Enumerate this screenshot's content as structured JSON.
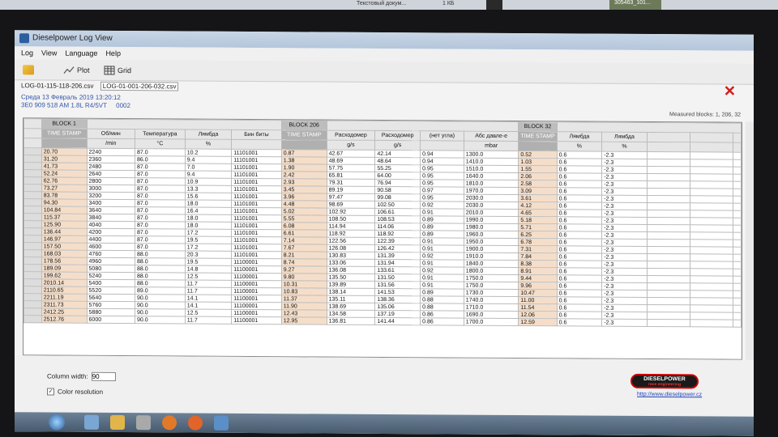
{
  "desktop": {
    "top_text": "Текстовый докум...",
    "top_size": "1 КБ",
    "thumb_label": "305463_101..."
  },
  "window": {
    "title": "Dieselpower Log View",
    "menu": [
      "Log",
      "View",
      "Language",
      "Help"
    ],
    "toolbar": {
      "plot": "Plot",
      "grid": "Grid"
    },
    "files": [
      "LOG-01-115-118-206.csv",
      "LOG-01-001-206-032.csv"
    ],
    "info_date": "Среда 13 Февраль 2019 13:20:12",
    "info_ecu": "3E0 909 518 AM  1.8L R4/5VT",
    "info_code": "0002",
    "measured": "Measured blocks: 1, 206, 32"
  },
  "grid": {
    "blocks": [
      "BLOCK 1",
      "BLOCK 206",
      "BLOCK 32"
    ],
    "headers": [
      "TIME STAMP",
      "Об/мин",
      "Температура",
      "Лямбда",
      "Бин биты",
      "TIME STAMP",
      "Расходомер",
      "Расходомер",
      "(нет угла)",
      "Абс давле-е",
      "TIME STAMP",
      "Лямбда",
      "Лямбда"
    ],
    "units": [
      "",
      "/min",
      "°C",
      "%",
      "",
      "",
      "g/s",
      "g/s",
      "",
      "mbar",
      "",
      "%",
      "%"
    ],
    "rows": [
      [
        "20.70",
        "2240",
        "87.0",
        "10.2",
        "11101001",
        "0.87",
        "42.67",
        "42.14",
        "0.94",
        "1300.0",
        "0.52",
        "0.6",
        "-2.3"
      ],
      [
        "31.20",
        "2360",
        "86.0",
        "9.4",
        "11101001",
        "1.38",
        "48.69",
        "48.64",
        "0.94",
        "1410.0",
        "1.03",
        "0.6",
        "-2.3"
      ],
      [
        "41.73",
        "2480",
        "87.0",
        "7.0",
        "11101001",
        "1.90",
        "57.75",
        "55.25",
        "0.95",
        "1510.0",
        "1.55",
        "0.6",
        "-2.3"
      ],
      [
        "52.24",
        "2640",
        "87.0",
        "9.4",
        "11101001",
        "2.42",
        "65.81",
        "64.00",
        "0.95",
        "1640.0",
        "2.06",
        "0.6",
        "-2.3"
      ],
      [
        "62.76",
        "2800",
        "87.0",
        "10.9",
        "11101001",
        "2.93",
        "79.31",
        "76.94",
        "0.95",
        "1810.0",
        "2.58",
        "0.6",
        "-2.3"
      ],
      [
        "73.27",
        "3000",
        "87.0",
        "13.3",
        "11101001",
        "3.45",
        "89.19",
        "90.58",
        "0.97",
        "1970.0",
        "3.09",
        "0.6",
        "-2.3"
      ],
      [
        "83.78",
        "3200",
        "87.0",
        "15.6",
        "11101001",
        "3.96",
        "97.47",
        "99.08",
        "0.95",
        "2030.0",
        "3.61",
        "0.6",
        "-2.3"
      ],
      [
        "94.30",
        "3400",
        "87.0",
        "18.0",
        "11101001",
        "4.48",
        "98.69",
        "102.50",
        "0.92",
        "2030.0",
        "4.12",
        "0.6",
        "-2.3"
      ],
      [
        "104.84",
        "3640",
        "87.0",
        "16.4",
        "11101001",
        "5.02",
        "102.92",
        "106.61",
        "0.91",
        "2010.0",
        "4.65",
        "0.6",
        "-2.3"
      ],
      [
        "115.37",
        "3840",
        "87.0",
        "18.0",
        "11101001",
        "5.55",
        "108.50",
        "108.53",
        "0.89",
        "1990.0",
        "5.18",
        "0.6",
        "-2.3"
      ],
      [
        "125.90",
        "4040",
        "87.0",
        "18.0",
        "11101001",
        "6.08",
        "114.94",
        "114.06",
        "0.89",
        "1980.0",
        "5.71",
        "0.6",
        "-2.3"
      ],
      [
        "136.44",
        "4200",
        "87.0",
        "17.2",
        "11101001",
        "6.61",
        "118.92",
        "118.92",
        "0.89",
        "1960.0",
        "6.25",
        "0.6",
        "-2.3"
      ],
      [
        "146.97",
        "4400",
        "87.0",
        "19.5",
        "11101001",
        "7.14",
        "122.56",
        "122.39",
        "0.91",
        "1950.0",
        "6.78",
        "0.6",
        "-2.3"
      ],
      [
        "157.50",
        "4600",
        "87.0",
        "17.2",
        "11101001",
        "7.67",
        "126.08",
        "126.42",
        "0.91",
        "1900.0",
        "7.31",
        "0.6",
        "-2.3"
      ],
      [
        "168.03",
        "4760",
        "88.0",
        "20.3",
        "11101001",
        "8.21",
        "130.83",
        "131.39",
        "0.92",
        "1910.0",
        "7.84",
        "0.6",
        "-2.3"
      ],
      [
        "178.56",
        "4960",
        "88.0",
        "19.5",
        "11100001",
        "8.74",
        "133.06",
        "131.94",
        "0.91",
        "1840.0",
        "8.38",
        "0.6",
        "-2.3"
      ],
      [
        "189.09",
        "5080",
        "88.0",
        "14.8",
        "11100001",
        "9.27",
        "136.08",
        "133.61",
        "0.92",
        "1800.0",
        "8.91",
        "0.6",
        "-2.3"
      ],
      [
        "199.62",
        "5240",
        "88.0",
        "12.5",
        "11100001",
        "9.80",
        "135.50",
        "131.50",
        "0.91",
        "1750.0",
        "9.44",
        "0.6",
        "-2.3"
      ],
      [
        "2010.14",
        "5400",
        "88.0",
        "11.7",
        "11100001",
        "10.31",
        "139.89",
        "131.56",
        "0.91",
        "1750.0",
        "9.96",
        "0.6",
        "-2.3"
      ],
      [
        "2110.65",
        "5520",
        "89.0",
        "11.7",
        "11100001",
        "10.83",
        "138.14",
        "141.53",
        "0.89",
        "1730.0",
        "10.47",
        "0.6",
        "-2.3"
      ],
      [
        "2211.19",
        "5640",
        "90.0",
        "14.1",
        "11100001",
        "11.37",
        "135.11",
        "138.36",
        "0.88",
        "1740.0",
        "11.00",
        "0.6",
        "-2.3"
      ],
      [
        "2311.73",
        "5760",
        "90.0",
        "14.1",
        "11100001",
        "11.90",
        "138.69",
        "135.06",
        "0.88",
        "1710.0",
        "11.54",
        "0.6",
        "-2.3"
      ],
      [
        "2412.25",
        "5880",
        "90.0",
        "12.5",
        "11100001",
        "12.43",
        "134.58",
        "137.19",
        "0.86",
        "1690.0",
        "12.06",
        "0.6",
        "-2.3"
      ],
      [
        "2512.76",
        "6000",
        "90.0",
        "11.7",
        "11100001",
        "12.95",
        "136.81",
        "141.44",
        "0.86",
        "1700.0",
        "12.59",
        "0.6",
        "-2.3"
      ]
    ]
  },
  "bottom": {
    "column_width_label": "Column width:",
    "column_width_value": "90",
    "color_resolution_label": "Color resolution",
    "logo_main": "DIESELPOWER",
    "logo_sub": "race engineering",
    "url": "http://www.dieselpower.cz"
  },
  "colors": {
    "accent_close": "#d21c1c",
    "timestamp_cell": "#f5dec9",
    "block_header": "#b0b0b0"
  }
}
